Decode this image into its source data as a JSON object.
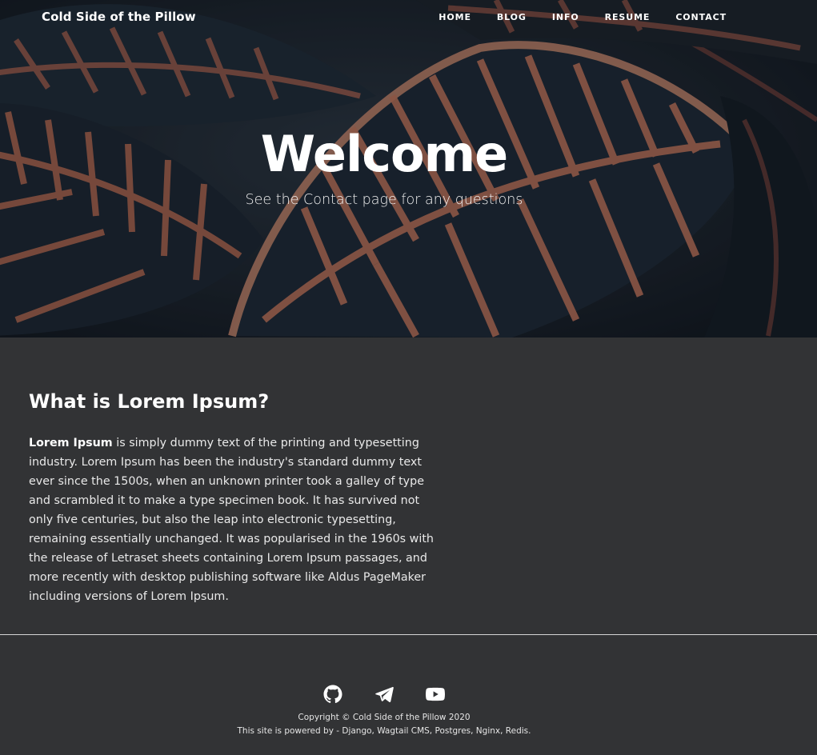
{
  "site": {
    "brand": "Cold Side of the Pillow"
  },
  "nav": {
    "items": [
      {
        "label": "HOME"
      },
      {
        "label": "BLOG"
      },
      {
        "label": "INFO"
      },
      {
        "label": "RESUME"
      },
      {
        "label": "CONTACT"
      }
    ]
  },
  "hero": {
    "title": "Welcome",
    "subtitle": "See the Contact page for any questions"
  },
  "article": {
    "heading": "What is Lorem Ipsum?",
    "lead": "Lorem Ipsum",
    "body": " is simply dummy text of the printing and typesetting industry. Lorem Ipsum has been the industry's standard dummy text ever since the 1500s, when an unknown printer took a galley of type and scrambled it to make a type specimen book. It has survived not only five centuries, but also the leap into electronic typesetting, remaining essentially unchanged. It was popularised in the 1960s with the release of Letraset sheets containing Lorem Ipsum passages, and more recently with desktop publishing software like Aldus PageMaker including versions of Lorem Ipsum."
  },
  "footer": {
    "social": [
      {
        "icon": "github-icon"
      },
      {
        "icon": "telegram-icon"
      },
      {
        "icon": "youtube-icon"
      }
    ],
    "copyright": "Copyright © Cold Side of the Pillow 2020",
    "powered_by": "This site is powered by - Django, Wagtail CMS, Postgres, Nginx, Redis."
  },
  "colors": {
    "background": "#323335",
    "text": "#ffffff",
    "leaf_vein": "#c0705a",
    "leaf_dark": "#1b2733"
  }
}
